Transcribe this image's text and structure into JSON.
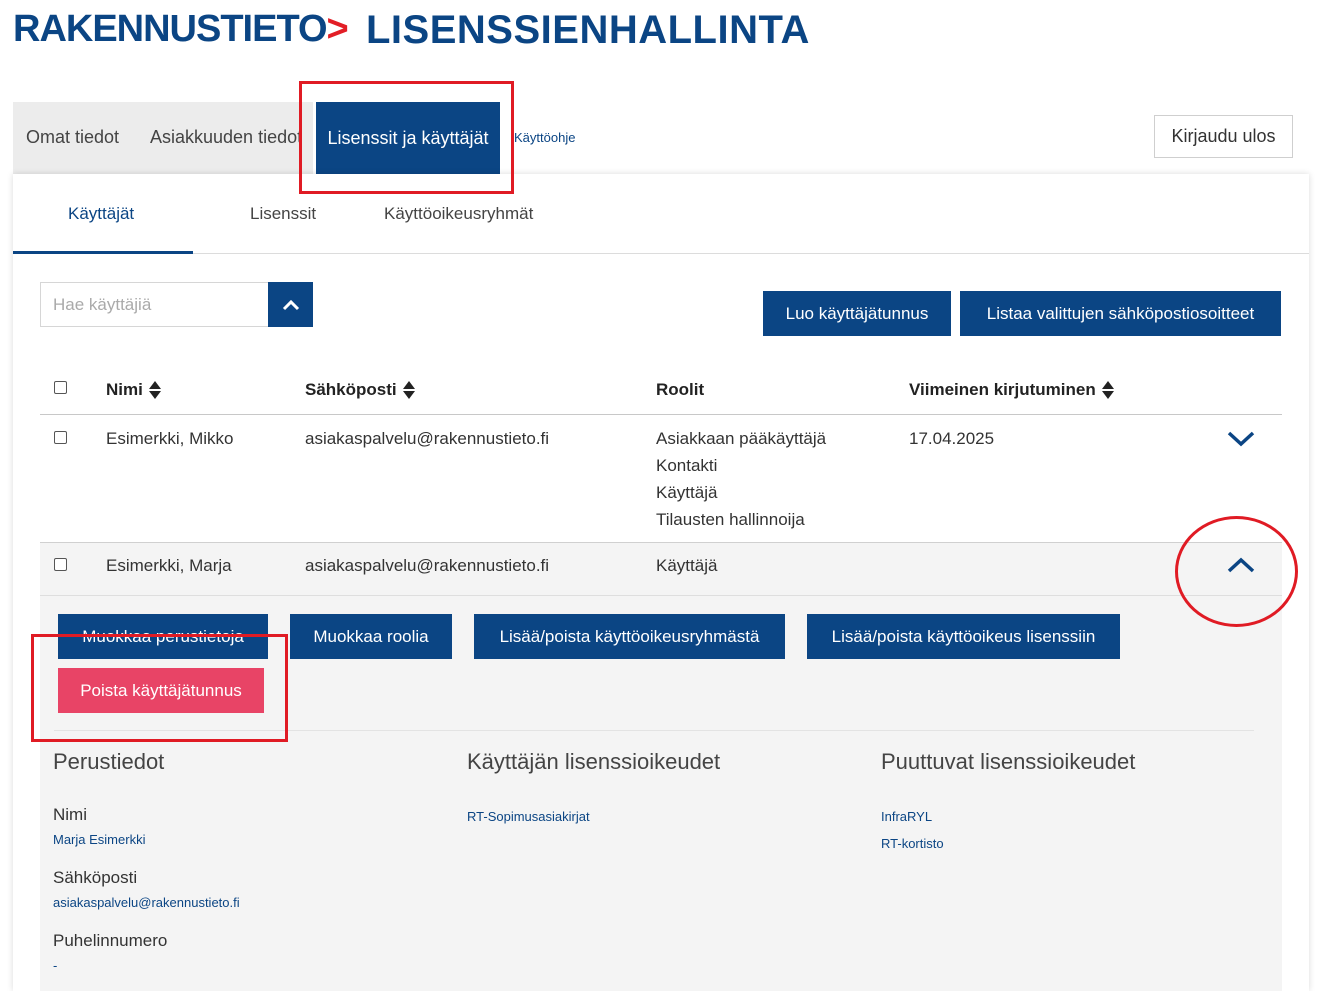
{
  "header": {
    "logo_text": "RAKENNUSTIETO",
    "app_title": "LISENSSIENHALLINTA"
  },
  "nav": {
    "items": [
      {
        "label": "Omat tiedot"
      },
      {
        "label": "Asiakkuuden tiedot"
      },
      {
        "label": "Lisenssit ja käyttäjät"
      }
    ],
    "help_link": "Käyttöohje",
    "logout": "Kirjaudu ulos"
  },
  "subtabs": [
    {
      "label": "Käyttäjät"
    },
    {
      "label": "Lisenssit"
    },
    {
      "label": "Käyttöoikeusryhmät"
    }
  ],
  "search": {
    "placeholder": "Hae käyttäjiä"
  },
  "actions": {
    "create_user": "Luo käyttäjätunnus",
    "list_emails": "Listaa valittujen sähköpostiosoitteet"
  },
  "table": {
    "headers": {
      "name": "Nimi",
      "email": "Sähköposti",
      "roles": "Roolit",
      "last_login": "Viimeinen kirjutuminen"
    },
    "rows": [
      {
        "name": "Esimerkki, Mikko",
        "email": "asiakaspalvelu@rakennustieto.fi",
        "roles": [
          "Asiakkaan pääkäyttäjä",
          "Kontakti",
          "Käyttäjä",
          "Tilausten hallinnoija"
        ],
        "last_login": "17.04.2025"
      },
      {
        "name": "Esimerkki, Marja",
        "email": "asiakaspalvelu@rakennustieto.fi",
        "roles": [
          "Käyttäjä"
        ],
        "last_login": ""
      }
    ]
  },
  "detail": {
    "buttons": {
      "edit_basic": "Muokkaa perustietoja",
      "edit_role": "Muokkaa roolia",
      "group_access": "Lisää/poista käyttöoikeusryhmästä",
      "license_access": "Lisää/poista käyttöoikeus lisenssiin",
      "delete_user": "Poista käyttäjätunnus"
    },
    "basic": {
      "title": "Perustiedot",
      "name_label": "Nimi",
      "name_value": "Marja Esimerkki",
      "email_label": "Sähköposti",
      "email_value": "asiakaspalvelu@rakennustieto.fi",
      "phone_label": "Puhelinnumero",
      "phone_value": "-"
    },
    "user_licenses": {
      "title": "Käyttäjän lisenssioikeudet",
      "items": [
        "RT-Sopimusasiakirjat"
      ]
    },
    "missing_licenses": {
      "title": "Puuttuvat lisenssioikeudet",
      "items": [
        "InfraRYL",
        "RT-kortisto"
      ]
    }
  },
  "colors": {
    "brand_blue": "#0b4584",
    "danger": "#e84466",
    "annotation_red": "#e01b24"
  }
}
